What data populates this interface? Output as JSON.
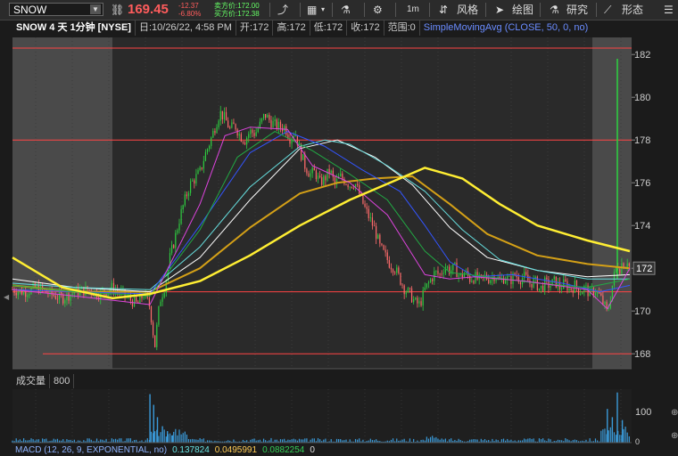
{
  "toolbar": {
    "symbol": "SNOW",
    "price": "169.45",
    "change": "-12.37",
    "change_pct": "-6.80%",
    "ask": "卖方价:172.00",
    "bid": "买方价:172.38",
    "interval": "1m",
    "style_label": "风格",
    "draw_label": "绘图",
    "study_label": "研究",
    "pattern_label": "形态"
  },
  "header": {
    "title": "SNOW 4 天 1分钟 [NYSE]",
    "date": "日:10/26/22, 4:58 PM",
    "open": "开:172",
    "high": "高:172",
    "low": "低:172",
    "close": "收:172",
    "range": "范围:0",
    "study": "SimpleMovingAvg (CLOSE, 50, 0, no)"
  },
  "volume": {
    "label": "成交量",
    "value": "800",
    "axis_tick": "100",
    "axis_tick_zero": "0"
  },
  "macd": {
    "label": "MACD (12, 26, 9, EXPONENTIAL, no)",
    "value": "0.137824",
    "avg": "0.0495991",
    "diff": "0.0882254",
    "extra": "0"
  },
  "colors": {
    "up": "#2ecc40",
    "down": "#ff6b6b",
    "sma_yellow": "#ffee33",
    "sma_gold": "#d4a017",
    "sma_cyan": "#66e0e0",
    "sma_blue": "#3355ff",
    "sma_magenta": "#dd44dd",
    "sma_green": "#22aa44",
    "sma_white": "#ffffff",
    "hline": "#ff4444",
    "volume": "#3a9ad9"
  },
  "chart_data": {
    "type": "candlestick",
    "y_ticks": [
      168,
      170,
      172,
      174,
      176,
      178,
      180,
      182
    ],
    "ylim": [
      167.3,
      182.8
    ],
    "last_price_label": "172",
    "horizontal_lines": [
      182.3,
      178.0,
      170.9,
      168.0
    ],
    "price_path": [
      [
        0,
        171.0
      ],
      [
        10,
        170.9
      ],
      [
        20,
        171.1
      ],
      [
        30,
        170.8
      ],
      [
        40,
        170.6
      ],
      [
        50,
        170.9
      ],
      [
        60,
        171.0
      ],
      [
        70,
        170.8
      ],
      [
        80,
        171.1
      ],
      [
        90,
        170.7
      ],
      [
        100,
        170.3
      ],
      [
        105,
        170.8
      ],
      [
        110,
        170.2
      ],
      [
        112,
        169.2
      ],
      [
        114,
        168.4
      ],
      [
        116,
        169.5
      ],
      [
        118,
        170.5
      ],
      [
        122,
        171.2
      ],
      [
        126,
        172.5
      ],
      [
        130,
        173.4
      ],
      [
        134,
        174.4
      ],
      [
        138,
        175.2
      ],
      [
        142,
        175.9
      ],
      [
        146,
        176.2
      ],
      [
        150,
        176.5
      ],
      [
        154,
        177.3
      ],
      [
        158,
        177.9
      ],
      [
        162,
        178.6
      ],
      [
        166,
        179.3
      ],
      [
        170,
        179.0
      ],
      [
        174,
        178.5
      ],
      [
        178,
        178.7
      ],
      [
        182,
        178.2
      ],
      [
        186,
        178.0
      ],
      [
        190,
        178.4
      ],
      [
        194,
        178.3
      ],
      [
        198,
        178.7
      ],
      [
        202,
        179.2
      ],
      [
        206,
        178.9
      ],
      [
        210,
        178.7
      ],
      [
        214,
        178.6
      ],
      [
        218,
        178.6
      ],
      [
        222,
        178.1
      ],
      [
        226,
        178.4
      ],
      [
        230,
        177.5
      ],
      [
        234,
        176.8
      ],
      [
        238,
        176.4
      ],
      [
        242,
        176.5
      ],
      [
        246,
        176.0
      ],
      [
        250,
        176.2
      ],
      [
        254,
        176.6
      ],
      [
        258,
        175.9
      ],
      [
        262,
        176.3
      ],
      [
        266,
        176.1
      ],
      [
        270,
        175.9
      ],
      [
        274,
        176.0
      ],
      [
        278,
        175.4
      ],
      [
        282,
        174.8
      ],
      [
        286,
        174.3
      ],
      [
        290,
        173.8
      ],
      [
        294,
        173.0
      ],
      [
        298,
        172.6
      ],
      [
        302,
        172.2
      ],
      [
        306,
        172.0
      ],
      [
        310,
        171.5
      ],
      [
        314,
        171.0
      ],
      [
        318,
        170.8
      ],
      [
        322,
        170.4
      ],
      [
        326,
        170.3
      ],
      [
        330,
        171.0
      ],
      [
        334,
        171.4
      ],
      [
        338,
        171.8
      ],
      [
        342,
        171.7
      ],
      [
        346,
        172.1
      ],
      [
        350,
        171.9
      ],
      [
        354,
        172.0
      ],
      [
        358,
        171.6
      ],
      [
        362,
        171.8
      ],
      [
        366,
        171.5
      ],
      [
        370,
        171.6
      ],
      [
        374,
        171.4
      ],
      [
        378,
        171.6
      ],
      [
        382,
        171.5
      ],
      [
        386,
        171.7
      ],
      [
        390,
        171.4
      ],
      [
        394,
        171.6
      ],
      [
        398,
        171.4
      ],
      [
        402,
        171.7
      ],
      [
        406,
        171.5
      ],
      [
        410,
        171.6
      ],
      [
        414,
        171.3
      ],
      [
        418,
        171.4
      ],
      [
        422,
        171.0
      ],
      [
        426,
        171.3
      ],
      [
        430,
        171.2
      ],
      [
        434,
        171.4
      ],
      [
        438,
        171.1
      ],
      [
        442,
        171.3
      ],
      [
        446,
        171.0
      ],
      [
        450,
        171.2
      ],
      [
        454,
        170.9
      ],
      [
        458,
        171.1
      ],
      [
        462,
        170.8
      ],
      [
        466,
        171.0
      ],
      [
        470,
        170.7
      ],
      [
        474,
        170.2
      ],
      [
        476,
        169.9
      ],
      [
        478,
        170.5
      ],
      [
        480,
        171.2
      ],
      [
        482,
        171.8
      ],
      [
        484,
        172.2
      ],
      [
        486,
        172.0
      ],
      [
        488,
        172.3
      ],
      [
        490,
        172.1
      ],
      [
        492,
        172.4
      ],
      [
        494,
        172.0
      ]
    ],
    "sma_yellow": [
      [
        0,
        172.5
      ],
      [
        40,
        171.1
      ],
      [
        80,
        170.6
      ],
      [
        110,
        170.8
      ],
      [
        150,
        171.4
      ],
      [
        190,
        172.6
      ],
      [
        230,
        174.0
      ],
      [
        270,
        175.2
      ],
      [
        310,
        176.2
      ],
      [
        330,
        176.7
      ],
      [
        360,
        176.2
      ],
      [
        390,
        175.0
      ],
      [
        420,
        174.0
      ],
      [
        460,
        173.3
      ],
      [
        494,
        172.8
      ]
    ],
    "sma_gold": [
      [
        0,
        171.2
      ],
      [
        50,
        170.9
      ],
      [
        110,
        170.9
      ],
      [
        150,
        172.0
      ],
      [
        190,
        173.9
      ],
      [
        230,
        175.5
      ],
      [
        260,
        176.0
      ],
      [
        290,
        176.2
      ],
      [
        320,
        176.3
      ],
      [
        350,
        175.0
      ],
      [
        380,
        173.6
      ],
      [
        420,
        172.6
      ],
      [
        460,
        172.2
      ],
      [
        494,
        172.0
      ]
    ],
    "sma_cyan": [
      [
        0,
        171.3
      ],
      [
        50,
        171.1
      ],
      [
        110,
        171.0
      ],
      [
        150,
        173.0
      ],
      [
        190,
        175.8
      ],
      [
        230,
        177.7
      ],
      [
        250,
        178.0
      ],
      [
        270,
        177.8
      ],
      [
        300,
        176.8
      ],
      [
        330,
        175.6
      ],
      [
        360,
        173.8
      ],
      [
        390,
        172.4
      ],
      [
        420,
        171.9
      ],
      [
        460,
        171.5
      ],
      [
        494,
        171.5
      ]
    ],
    "sma_blue": [
      [
        0,
        171.0
      ],
      [
        50,
        170.9
      ],
      [
        110,
        170.8
      ],
      [
        150,
        174.0
      ],
      [
        190,
        177.4
      ],
      [
        220,
        178.4
      ],
      [
        250,
        177.7
      ],
      [
        280,
        176.6
      ],
      [
        310,
        175.6
      ],
      [
        330,
        174.0
      ],
      [
        350,
        172.3
      ],
      [
        370,
        171.6
      ],
      [
        400,
        171.7
      ],
      [
        440,
        171.3
      ],
      [
        470,
        170.9
      ],
      [
        494,
        171.2
      ]
    ],
    "sma_magenta": [
      [
        0,
        171.0
      ],
      [
        50,
        170.7
      ],
      [
        110,
        170.3
      ],
      [
        150,
        175.0
      ],
      [
        170,
        178.2
      ],
      [
        190,
        178.6
      ],
      [
        220,
        178.5
      ],
      [
        240,
        176.8
      ],
      [
        270,
        176.0
      ],
      [
        300,
        174.5
      ],
      [
        330,
        171.7
      ],
      [
        350,
        171.5
      ],
      [
        370,
        171.6
      ],
      [
        410,
        171.4
      ],
      [
        460,
        171.0
      ],
      [
        476,
        170.1
      ],
      [
        494,
        172.0
      ]
    ],
    "sma_green": [
      [
        0,
        171.2
      ],
      [
        50,
        170.9
      ],
      [
        110,
        170.7
      ],
      [
        150,
        173.8
      ],
      [
        180,
        177.2
      ],
      [
        210,
        178.4
      ],
      [
        240,
        177.5
      ],
      [
        270,
        176.4
      ],
      [
        300,
        175.2
      ],
      [
        330,
        172.8
      ],
      [
        350,
        171.8
      ],
      [
        380,
        171.6
      ],
      [
        420,
        171.3
      ],
      [
        460,
        171.1
      ],
      [
        494,
        171.5
      ]
    ],
    "sma_white": [
      [
        0,
        171.5
      ],
      [
        50,
        171.1
      ],
      [
        110,
        170.9
      ],
      [
        150,
        172.5
      ],
      [
        190,
        175.2
      ],
      [
        230,
        177.6
      ],
      [
        260,
        178.0
      ],
      [
        290,
        177.2
      ],
      [
        320,
        175.9
      ],
      [
        350,
        173.9
      ],
      [
        380,
        172.5
      ],
      [
        420,
        171.9
      ],
      [
        460,
        171.6
      ],
      [
        494,
        171.7
      ]
    ],
    "volume": {
      "ylim": [
        0,
        130
      ],
      "spikes": [
        [
          110,
          118
        ],
        [
          113,
          92
        ],
        [
          116,
          62
        ],
        [
          120,
          40
        ],
        [
          124,
          28
        ],
        [
          128,
          18
        ],
        [
          476,
          82
        ],
        [
          480,
          62
        ],
        [
          484,
          122
        ],
        [
          488,
          55
        ]
      ]
    }
  }
}
